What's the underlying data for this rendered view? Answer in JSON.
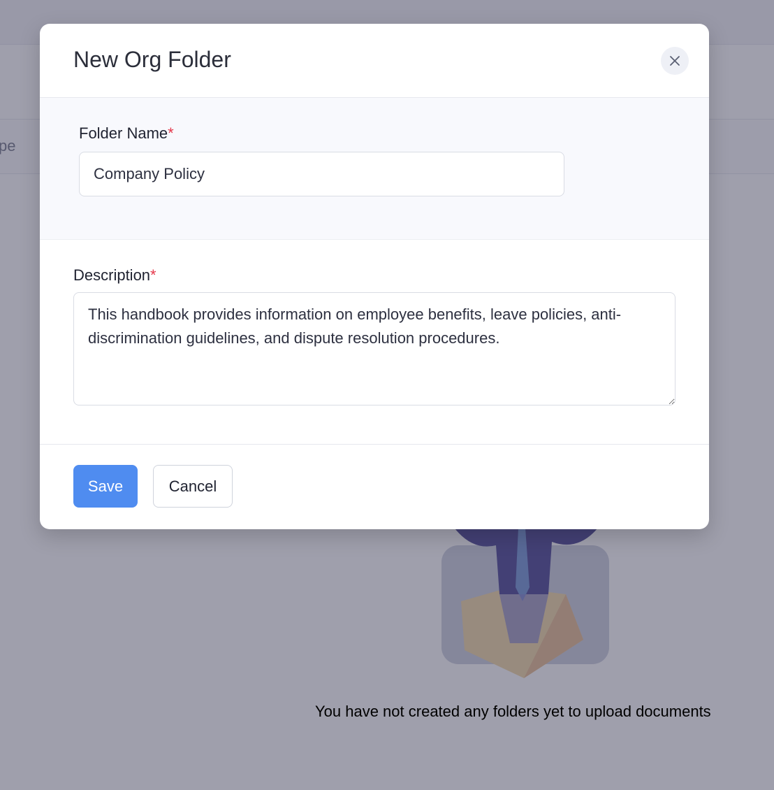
{
  "background": {
    "column_fragment": "pe",
    "empty_message": "You have not created any folders yet to upload documents"
  },
  "modal": {
    "title": "New Org Folder",
    "close_icon": "close-icon",
    "folder_name": {
      "label": "Folder Name",
      "required_mark": "*",
      "value": "Company Policy"
    },
    "description": {
      "label": "Description",
      "required_mark": "*",
      "value": "This handbook provides information on employee benefits, leave policies, anti-discrimination guidelines, and dispute resolution procedures."
    },
    "footer": {
      "save_label": "Save",
      "cancel_label": "Cancel"
    }
  },
  "colors": {
    "primary": "#4f8cf0",
    "required": "#e5384b",
    "overlay": "rgba(70,70,96,0.52)"
  }
}
